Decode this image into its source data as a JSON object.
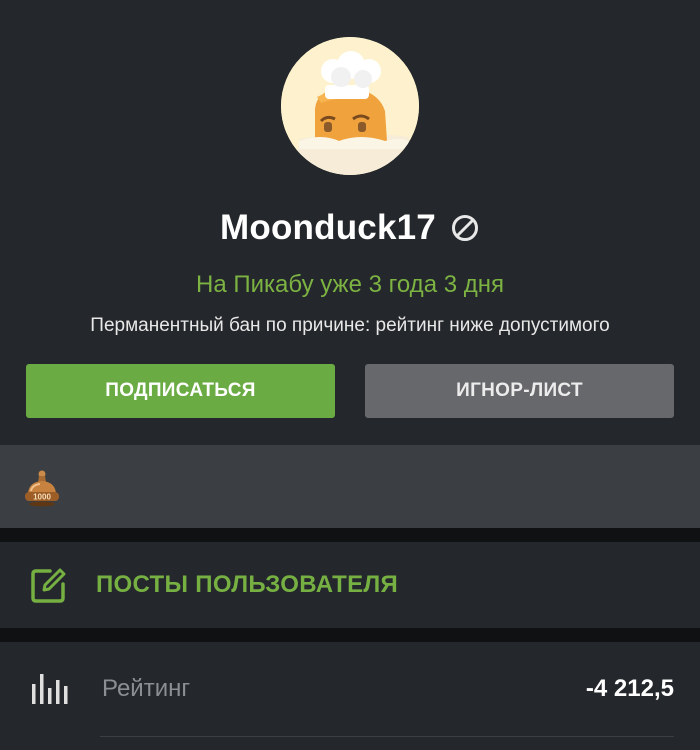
{
  "profile": {
    "username": "Moonduck17",
    "since": "На Пикабу уже 3 года 3 дня",
    "ban_reason": "Перманентный бан по причине: рейтинг ниже допустимого",
    "avatar_icon": "chef-hat-avatar",
    "status_icon": "ban-icon"
  },
  "actions": {
    "subscribe_label": "ПОДПИСАТЬСЯ",
    "ignore_label": "ИГНОР-ЛИСТ"
  },
  "awards": {
    "items": [
      {
        "icon": "award-1000-badge",
        "text": "1000"
      }
    ]
  },
  "sections": {
    "posts_label": "ПОСТЫ ПОЛЬЗОВАТЕЛЯ",
    "posts_icon": "edit-icon"
  },
  "stats": {
    "rating_label": "Рейтинг",
    "rating_value": "-4 212,5",
    "rating_icon": "bar-chart-icon"
  },
  "colors": {
    "accent_green": "#6aab44",
    "panel": "#24272b",
    "background": "#101113"
  }
}
